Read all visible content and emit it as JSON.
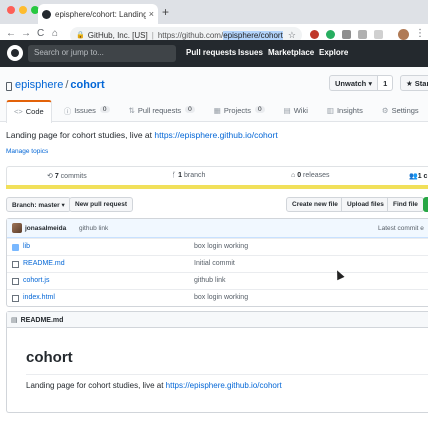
{
  "browser": {
    "tab_title": "episphere/cohort: Landing pag",
    "tab_close": "×",
    "new_tab": "+",
    "back": "←",
    "forward": "→",
    "reload": "C",
    "home": "⌂",
    "secure_label": "GitHub, Inc. [US]",
    "url_host": "https://github.com/",
    "url_path": "episphere/cohort",
    "bookmark": "☆",
    "menu": "⋮"
  },
  "github": {
    "search_placeholder": "Search or jump to...",
    "nav": [
      "Pull requests",
      "Issues",
      "Marketplace",
      "Explore"
    ]
  },
  "repo": {
    "owner": "episphere",
    "name": "cohort",
    "unwatch_label": "Unwatch ▾",
    "watch_count": "1",
    "star_label": "★ Star",
    "tabs": [
      {
        "icon": "<>",
        "label": "Code",
        "count": ""
      },
      {
        "icon": "ⓘ",
        "label": "Issues",
        "count": "0"
      },
      {
        "icon": "⇅",
        "label": "Pull requests",
        "count": "0"
      },
      {
        "icon": "▦",
        "label": "Projects",
        "count": "0"
      },
      {
        "icon": "▤",
        "label": "Wiki",
        "count": ""
      },
      {
        "icon": "▥",
        "label": "Insights",
        "count": ""
      },
      {
        "icon": "⚙",
        "label": "Settings",
        "count": ""
      }
    ],
    "description_text": "Landing page for cohort studies, live at ",
    "description_link": "https://episphere.github.io/cohort",
    "manage_topics": "Manage topics"
  },
  "stats": {
    "commits_count": "7",
    "commits_label": "commits",
    "branch_count": "1",
    "branch_label": "branch",
    "releases_count": "0",
    "releases_label": "releases",
    "contributors_partial": "1 c"
  },
  "branch_row": {
    "branch_select": "Branch: master ▾",
    "new_pr": "New pull request",
    "create_file": "Create new file",
    "upload_files": "Upload files",
    "find_file": "Find file"
  },
  "commit": {
    "author": "jonasalmeida",
    "message": "github link",
    "latest": "Latest commit e"
  },
  "files": [
    {
      "type": "dir",
      "name": "lib",
      "message": "box login working"
    },
    {
      "type": "file",
      "name": "README.md",
      "message": "Initial commit"
    },
    {
      "type": "file",
      "name": "cohort.js",
      "message": "github link"
    },
    {
      "type": "file",
      "name": "index.html",
      "message": "box login working"
    }
  ],
  "readme": {
    "header": "README.md",
    "heading": "cohort",
    "text": "Landing page for cohort studies, live at ",
    "link": "https://episphere.github.io/cohort"
  }
}
